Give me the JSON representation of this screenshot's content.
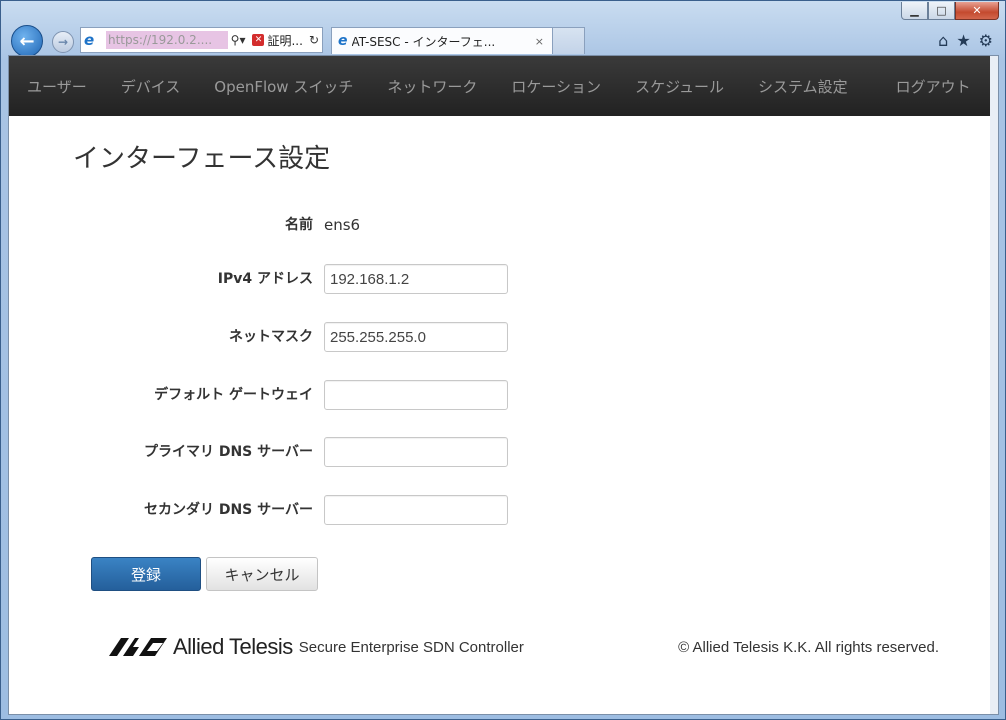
{
  "browser": {
    "address_url": "https://192.0.2....",
    "cert_label": "証明...",
    "tab_title": "AT-SESC - インターフェ...",
    "tab_close": "×"
  },
  "window": {
    "minimize": "▁",
    "maximize": "□",
    "close": "✕"
  },
  "nav": {
    "items": [
      {
        "label": "ユーザー"
      },
      {
        "label": "デバイス"
      },
      {
        "label": "OpenFlow スイッチ"
      },
      {
        "label": "ネットワーク"
      },
      {
        "label": "ロケーション"
      },
      {
        "label": "スケジュール"
      },
      {
        "label": "システム設定"
      },
      {
        "label": "ログアウト"
      }
    ]
  },
  "page": {
    "title": "インターフェース設定"
  },
  "form": {
    "name_label": "名前",
    "name_value": "ens6",
    "ipv4_label": "IPv4 アドレス",
    "ipv4_value": "192.168.1.2",
    "netmask_label": "ネットマスク",
    "netmask_value": "255.255.255.0",
    "gateway_label": "デフォルト ゲートウェイ",
    "gateway_value": "",
    "dns1_label": "プライマリ DNS サーバー",
    "dns1_value": "",
    "dns2_label": "セカンダリ DNS サーバー",
    "dns2_value": ""
  },
  "buttons": {
    "submit": "登録",
    "cancel": "キャンセル"
  },
  "footer": {
    "brand": "Allied Telesis",
    "product": "Secure Enterprise SDN Controller",
    "copyright": "© Allied Telesis K.K. All rights reserved."
  },
  "colors": {
    "navbar_bg": "#2b2b2b",
    "primary_button": "#2d6fae"
  }
}
